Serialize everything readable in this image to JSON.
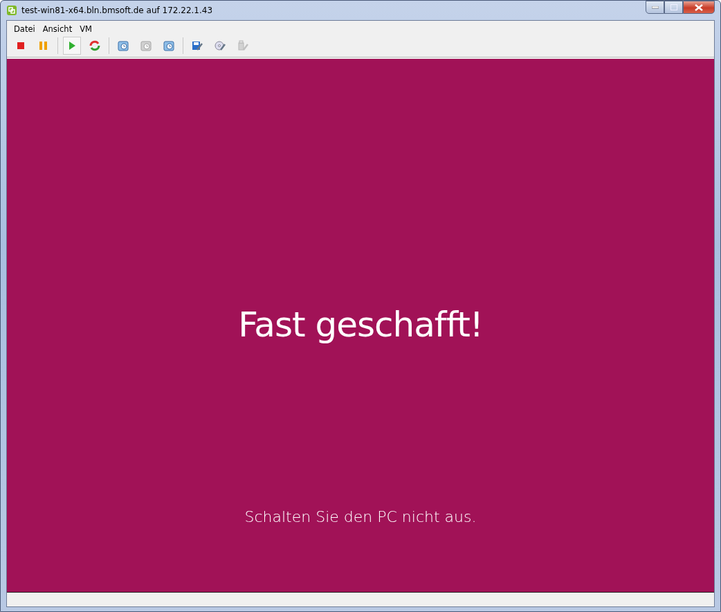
{
  "window": {
    "title": "test-win81-x64.bln.bmsoft.de auf 172.22.1.43"
  },
  "menu": [
    "Datei",
    "Ansicht",
    "VM"
  ],
  "toolbar": [
    {
      "kind": "stop",
      "pressed": false,
      "disabled": false
    },
    {
      "kind": "pause",
      "pressed": false,
      "disabled": false
    },
    {
      "kind": "play",
      "pressed": true,
      "disabled": false
    },
    {
      "kind": "reset",
      "pressed": false,
      "disabled": false
    },
    {
      "kind": "snapshot",
      "pressed": false,
      "disabled": false
    },
    {
      "kind": "revert",
      "pressed": false,
      "disabled": true
    },
    {
      "kind": "manager",
      "pressed": false,
      "disabled": false
    },
    {
      "kind": "settings",
      "pressed": false,
      "disabled": false
    },
    {
      "kind": "disc",
      "pressed": false,
      "disabled": false
    },
    {
      "kind": "usb",
      "pressed": false,
      "disabled": true
    }
  ],
  "console": {
    "heading": "Fast geschafft!",
    "message": "Schalten Sie den PC nicht aus."
  }
}
